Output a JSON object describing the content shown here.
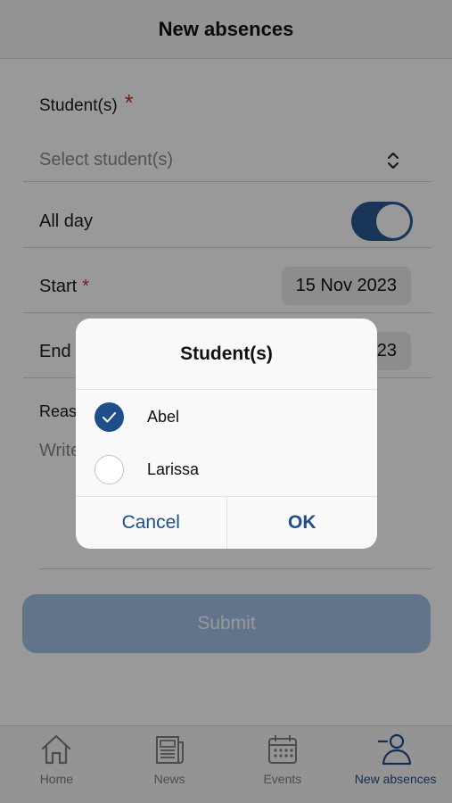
{
  "header": {
    "title": "New absences"
  },
  "form": {
    "students_label": "Student(s)",
    "required_mark": "*",
    "students_placeholder": "Select student(s)",
    "all_day_label": "All day",
    "all_day_on": true,
    "start_label": "Start",
    "start_date": "15 Nov 2023",
    "end_label": "End",
    "end_date": "15 Nov 2023",
    "reason_label": "Reason",
    "reason_placeholder": "Write a reason"
  },
  "submit_label": "Submit",
  "dialog": {
    "title": "Student(s)",
    "options": [
      {
        "label": "Abel",
        "checked": true
      },
      {
        "label": "Larissa",
        "checked": false
      }
    ],
    "cancel_label": "Cancel",
    "ok_label": "OK"
  },
  "tabbar": {
    "items": [
      {
        "label": "Home",
        "icon": "home-icon"
      },
      {
        "label": "News",
        "icon": "news-icon"
      },
      {
        "label": "Events",
        "icon": "calendar-icon"
      },
      {
        "label": "New absences",
        "icon": "person-minus-icon",
        "active": true
      }
    ]
  },
  "colors": {
    "accent": "#1f4e8a",
    "submit_bg": "#a3c2e6",
    "required": "#c0392b"
  }
}
